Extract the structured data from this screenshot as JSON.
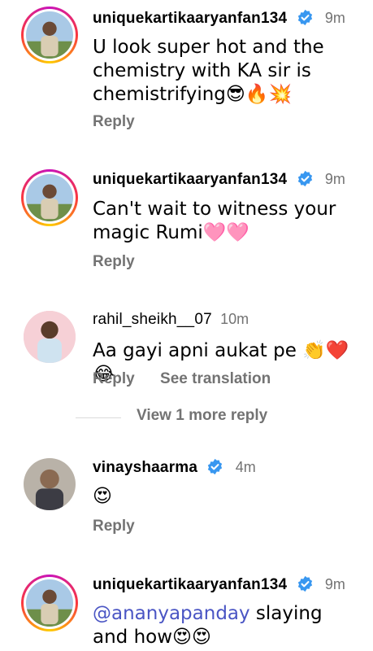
{
  "comments": [
    {
      "username": "uniquekartikaaryanfan134",
      "time": "9m",
      "text": "U look super hot and the chemistry with KA sir is chemistrifying😎🔥💥",
      "reply_label": "Reply"
    },
    {
      "username": "uniquekartikaaryanfan134",
      "time": "9m",
      "text": "Can't wait to witness your magic Rumi🩷🩷",
      "reply_label": "Reply"
    },
    {
      "username": "rahil_sheikh__07",
      "time": "10m",
      "text": "Aa gayi apni aukat pe 👏❤️😂",
      "reply_label": "Reply",
      "translate_label": "See translation"
    },
    {
      "username": "vinayshaarma",
      "time": "4m",
      "text": "😍",
      "reply_label": "Reply"
    },
    {
      "username": "uniquekartikaaryanfan134",
      "time": "9m",
      "mention": "@ananyapanday",
      "text": " slaying and how😍😍"
    }
  ],
  "view_more_label": "View 1 more reply",
  "colors": {
    "verified": "#3897f0",
    "secondary_text": "#737373",
    "mention": "#4a55c4"
  },
  "icons": [
    "verified-badge-icon",
    "avatar"
  ]
}
